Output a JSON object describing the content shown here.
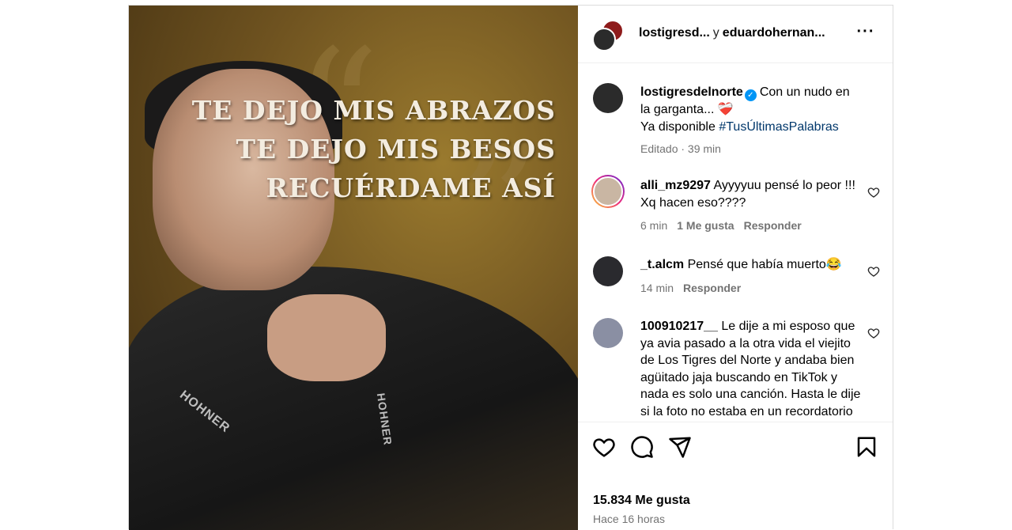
{
  "post": {
    "image_text": {
      "line1": "TE DEJO MIS ABRAZOS",
      "line2": "TE DEJO MIS BESOS",
      "line3": "RECUÉRDAME ASÍ",
      "brand1": "HOHNER",
      "brand2": "HOHNER"
    }
  },
  "header": {
    "user1": "lostigresd...",
    "connector": "y",
    "user2": "eduardohernan...",
    "more_icon": "more-horizontal-icon"
  },
  "caption": {
    "user": "lostigresdelnorte",
    "text": "Con un nudo en la garganta... ❤️‍🩹",
    "line2_prefix": "Ya disponible",
    "hashtag": "#TusÚltimasPalabras",
    "meta": "Editado · 39 min"
  },
  "comments": [
    {
      "user": "alli_mz9297",
      "text": "Ayyyyuu pensé lo peor !!! Xq hacen eso????",
      "time": "6 min",
      "likes": "1 Me gusta",
      "reply": "Responder"
    },
    {
      "user": "_t.alcm",
      "text": "Pensé que había muerto😂",
      "time": "14 min",
      "reply": "Responder"
    },
    {
      "user": "100910217__",
      "text": "Le dije a mi esposo que ya avia pasado a la otra vida el viejito de Los Tigres del Norte y andaba bien agüitado jaja buscando en TikTok y nada es solo una canción. Hasta le dije si la foto no estaba en un recordatorio",
      "time": "",
      "reply": ""
    }
  ],
  "actions": {
    "likes": "15.834 Me gusta",
    "time": "Hace 16 horas"
  },
  "colors": {
    "link": "#00376b",
    "verified": "#0095f6",
    "muted": "#737373"
  }
}
